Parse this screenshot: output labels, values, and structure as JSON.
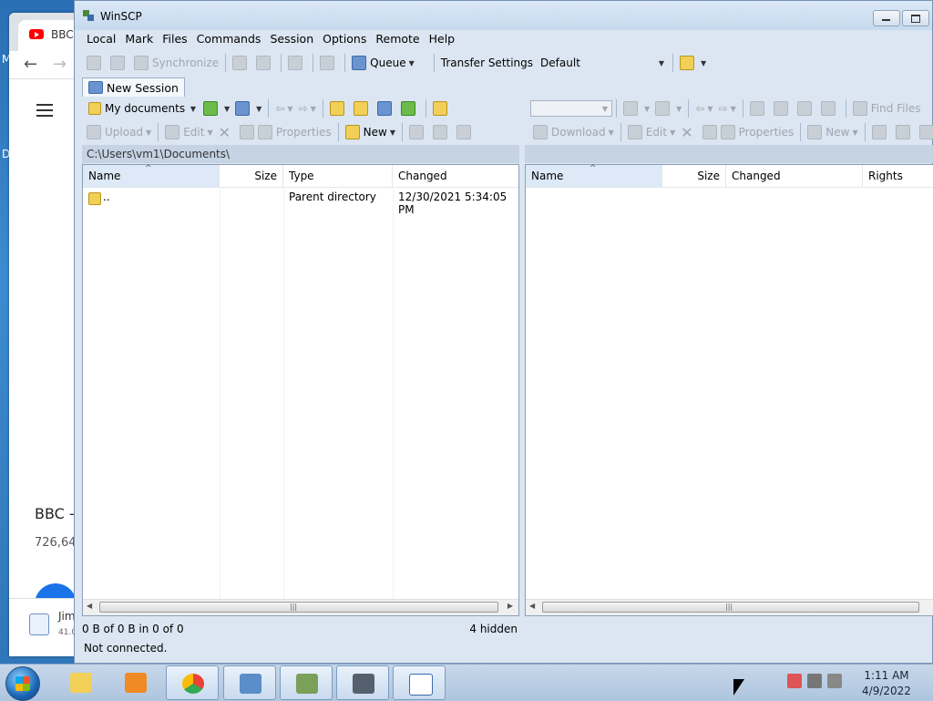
{
  "desktop": {
    "label_m": "M",
    "label_d": "D"
  },
  "browser": {
    "tab_title": "BBC",
    "video_title": "BBC -",
    "views": "726,64",
    "download_name": "Jim",
    "download_size": "41.0"
  },
  "window": {
    "title": "WinSCP",
    "menu": [
      "Local",
      "Mark",
      "Files",
      "Commands",
      "Session",
      "Options",
      "Remote",
      "Help"
    ],
    "toolbar": {
      "synchronize": "Synchronize",
      "queue": "Queue",
      "transfer_settings_label": "Transfer Settings",
      "transfer_settings_value": "Default"
    },
    "session_tab": "New Session",
    "left": {
      "location_combo": "My documents",
      "actions": {
        "upload": "Upload",
        "edit": "Edit",
        "properties": "Properties",
        "new": "New"
      },
      "path": "C:\\Users\\vm1\\Documents\\",
      "columns": [
        "Name",
        "Size",
        "Type",
        "Changed"
      ],
      "rows": [
        {
          "name": "..",
          "size": "",
          "type": "Parent directory",
          "changed": "12/30/2021  5:34:05 PM"
        }
      ],
      "status": "0 B of 0 B in 0 of 0",
      "hidden": "4 hidden"
    },
    "right": {
      "find_files": "Find Files",
      "actions": {
        "download": "Download",
        "edit": "Edit",
        "properties": "Properties",
        "new": "New"
      },
      "columns": [
        "Name",
        "Size",
        "Changed",
        "Rights"
      ]
    },
    "connection_status": "Not connected."
  },
  "taskbar": {
    "clock_time": "1:11 AM",
    "clock_date": "4/9/2022",
    "apps": [
      "explorer-icon",
      "media-player-icon",
      "chrome-icon",
      "control-panel-icon",
      "winscp-icon",
      "puttygen-icon",
      "eyes-icon"
    ]
  }
}
